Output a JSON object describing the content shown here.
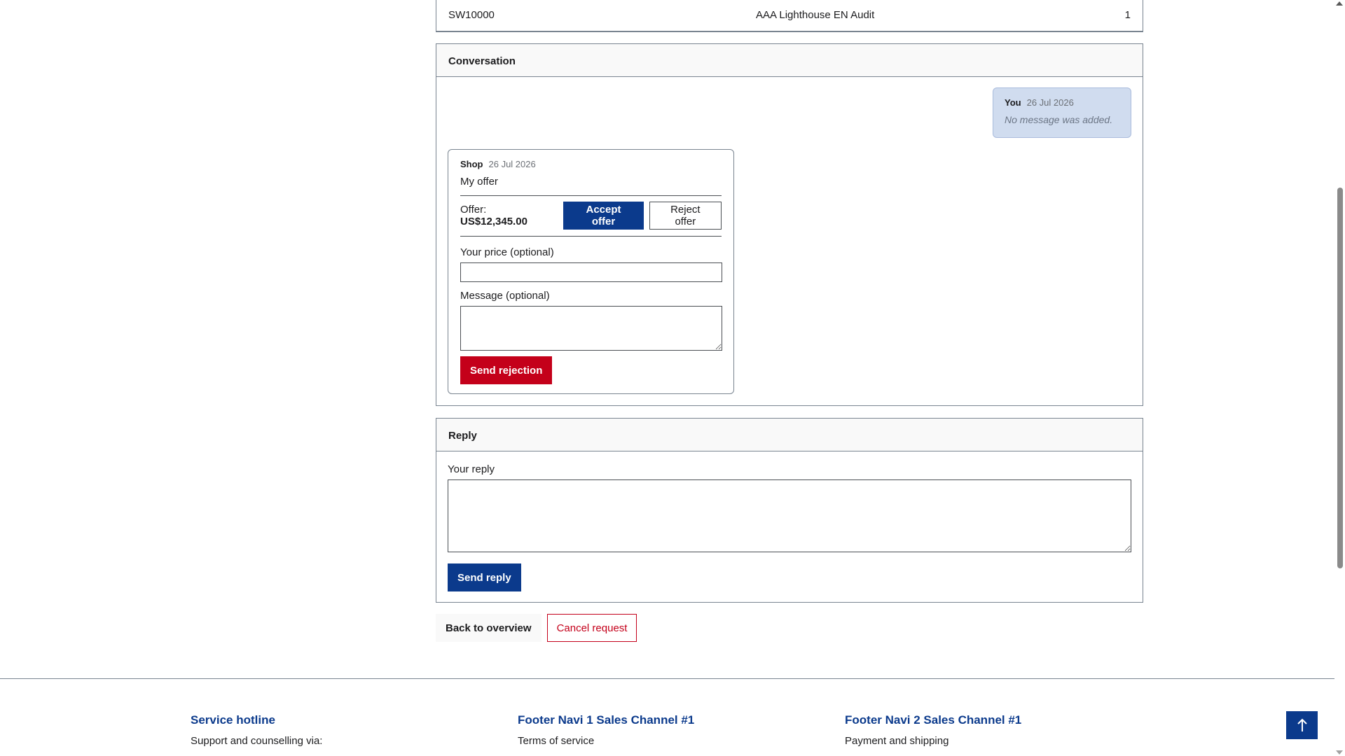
{
  "line_item": {
    "number": "SW10000",
    "name": "AAA Lighthouse EN Audit",
    "quantity": "1"
  },
  "conversation": {
    "title": "Conversation",
    "you_message": {
      "author": "You",
      "date": "26 Jul 2026",
      "text": "No message was added."
    },
    "shop_message": {
      "author": "Shop",
      "date": "26 Jul 2026",
      "title": "My offer",
      "offer_label": "Offer:",
      "offer_value": "US$12,345.00",
      "accept_label": "Accept offer",
      "reject_label": "Reject offer",
      "price_label": "Your price (optional)",
      "price_value": "",
      "message_label": "Message (optional)",
      "message_value": "",
      "send_rejection_label": "Send rejection"
    }
  },
  "reply": {
    "title": "Reply",
    "field_label": "Your reply",
    "field_value": "",
    "send_label": "Send reply"
  },
  "actions": {
    "back_label": "Back to overview",
    "cancel_label": "Cancel request"
  },
  "footer": {
    "col1": {
      "title": "Service hotline",
      "text": "Support and counselling via:"
    },
    "col2": {
      "title": "Footer Navi 1 Sales Channel #1",
      "link": "Terms of service"
    },
    "col3": {
      "title": "Footer Navi 2 Sales Channel #1",
      "link": "Payment and shipping"
    }
  },
  "icons": {
    "scroll_top": "arrow-up-icon"
  },
  "colors": {
    "primary": "#0b3a8c",
    "danger": "#c4001a",
    "you_bubble": "#d0dcef"
  }
}
